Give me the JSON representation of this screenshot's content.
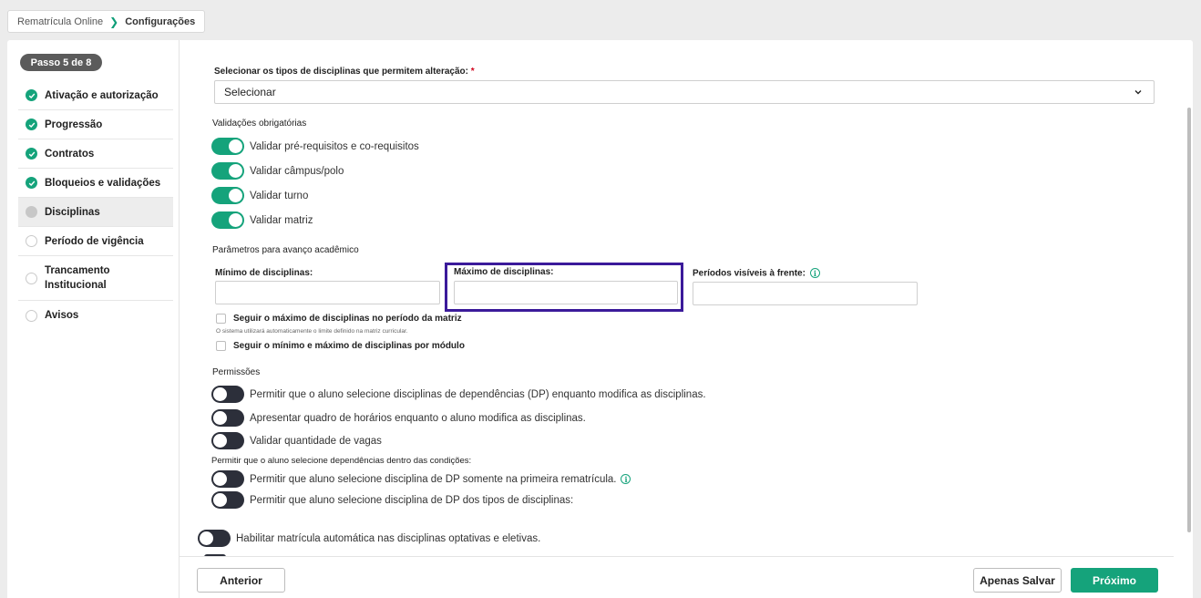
{
  "breadcrumb": {
    "parent": "Rematrícula Online",
    "current": "Configurações"
  },
  "sidebar": {
    "step_badge": "Passo 5 de 8",
    "steps": [
      {
        "label": "Ativação e autorização",
        "status": "done"
      },
      {
        "label": "Progressão",
        "status": "done"
      },
      {
        "label": "Contratos",
        "status": "done"
      },
      {
        "label": "Bloqueios e validações",
        "status": "done"
      },
      {
        "label": "Disciplinas",
        "status": "current"
      },
      {
        "label": "Período de vigência",
        "status": "pending"
      },
      {
        "label": "Trancamento Institucional",
        "status": "pending"
      },
      {
        "label": "Avisos",
        "status": "pending"
      }
    ]
  },
  "discipline_types": {
    "label": "Selecionar os tipos de disciplinas que permitem alteração:",
    "required_mark": "*",
    "value": "Selecionar"
  },
  "validations": {
    "title": "Validações obrigatórias",
    "items": [
      {
        "label": "Validar pré-requisitos e co-requisitos",
        "on": true
      },
      {
        "label": "Validar câmpus/polo",
        "on": true
      },
      {
        "label": "Validar turno",
        "on": true
      },
      {
        "label": "Validar matriz",
        "on": true
      }
    ]
  },
  "academic": {
    "title": "Parâmetros para avanço acadêmico",
    "min_label": "Mínimo de disciplinas:",
    "max_label": "Máximo de disciplinas:",
    "periods_label": "Períodos visíveis à frente:",
    "min_value": "",
    "max_value": "",
    "periods_value": "",
    "check_max_label": "Seguir o máximo de disciplinas no período da matriz",
    "check_max_hint": "O sistema utilizará automaticamente o limite definido na matriz curricular.",
    "check_module_label": "Seguir o mínimo e máximo de disciplinas por módulo"
  },
  "permissions": {
    "title": "Permissões",
    "items": [
      {
        "label": "Permitir que o aluno selecione disciplinas de dependências (DP) enquanto modifica as disciplinas.",
        "on": false
      },
      {
        "label": "Apresentar quadro de horários enquanto o aluno modifica as disciplinas.",
        "on": false
      },
      {
        "label": "Validar quantidade de vagas",
        "on": false
      }
    ],
    "conditions_title": "Permitir que o aluno selecione dependências dentro das condições:",
    "conditions": [
      {
        "label": "Permitir que aluno selecione disciplina de DP somente na primeira rematrícula.",
        "on": false
      },
      {
        "label": "Permitir que aluno selecione disciplina de DP dos tipos de disciplinas:",
        "on": false
      }
    ]
  },
  "auto_enroll": {
    "label": "Habilitar matrícula automática nas disciplinas optativas e eletivas.",
    "on": false
  },
  "footer": {
    "back": "Anterior",
    "save": "Apenas Salvar",
    "next": "Próximo"
  },
  "colors": {
    "accent": "#15a37b",
    "toggle_off": "#2c2f3a",
    "highlight": "#3b1a9a"
  }
}
